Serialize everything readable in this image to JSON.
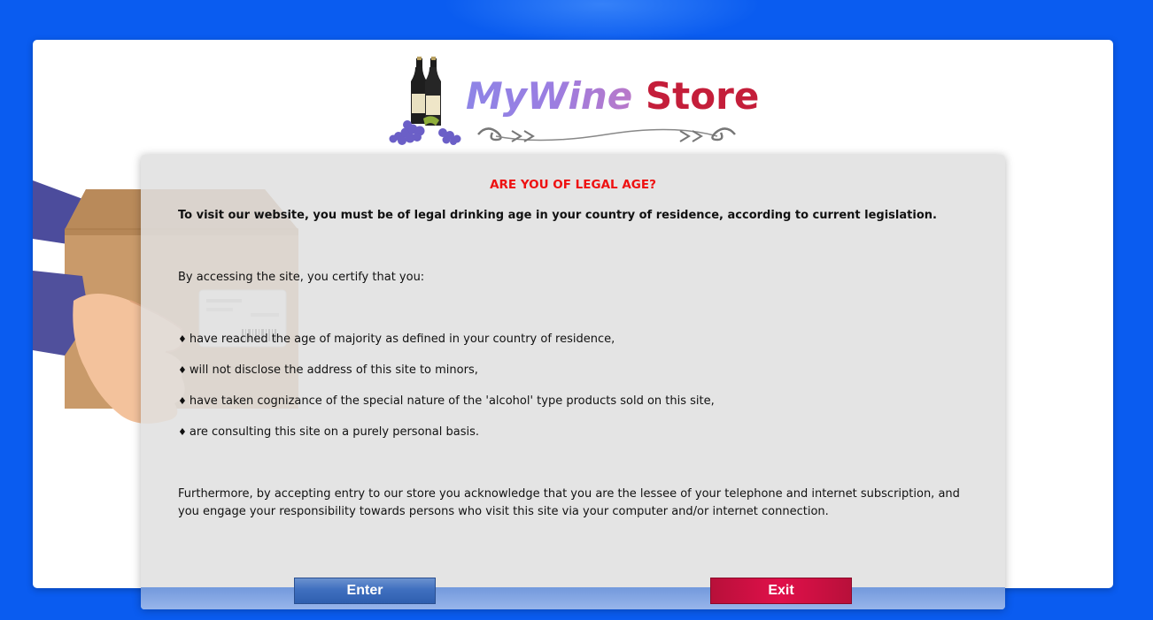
{
  "logo": {
    "brand_part1": "MyWine",
    "brand_part2": "Store",
    "icons": [
      "wine-bottles-icon",
      "grapes-icon",
      "flourish-ornament-icon"
    ]
  },
  "illustration": {
    "icon": "delivery-box-hands-icon"
  },
  "modal": {
    "title": "ARE YOU OF LEGAL AGE?",
    "intro": "To visit our website, you must be of legal drinking age in your country of residence, according to current legislation.",
    "certify": "By accessing the site, you certify that you:",
    "bullet_symbol": "♦",
    "bullets": [
      "have reached the age of majority as defined in your country of residence,",
      "will not disclose the address of this site to minors,",
      "have taken cognizance of the special nature of the 'alcohol' type products sold on this site,",
      "are consulting this site on a purely personal basis."
    ],
    "paragraph_line1": "Furthermore, by accepting entry to our store you acknowledge that you are the lessee of your telephone and internet subscription, and",
    "paragraph_line2": "you engage your responsibility towards persons who visit this site via your computer and/or internet connection."
  },
  "buttons": {
    "enter_label": "Enter",
    "exit_label": "Exit"
  },
  "colors": {
    "page_background": "#0a5cf0",
    "title_red": "#ee1111",
    "brand_purple": "#9a7ee2",
    "brand_red": "#c41e3a",
    "enter_blue": "#3f6fbf",
    "exit_crimson": "#d0103f"
  }
}
